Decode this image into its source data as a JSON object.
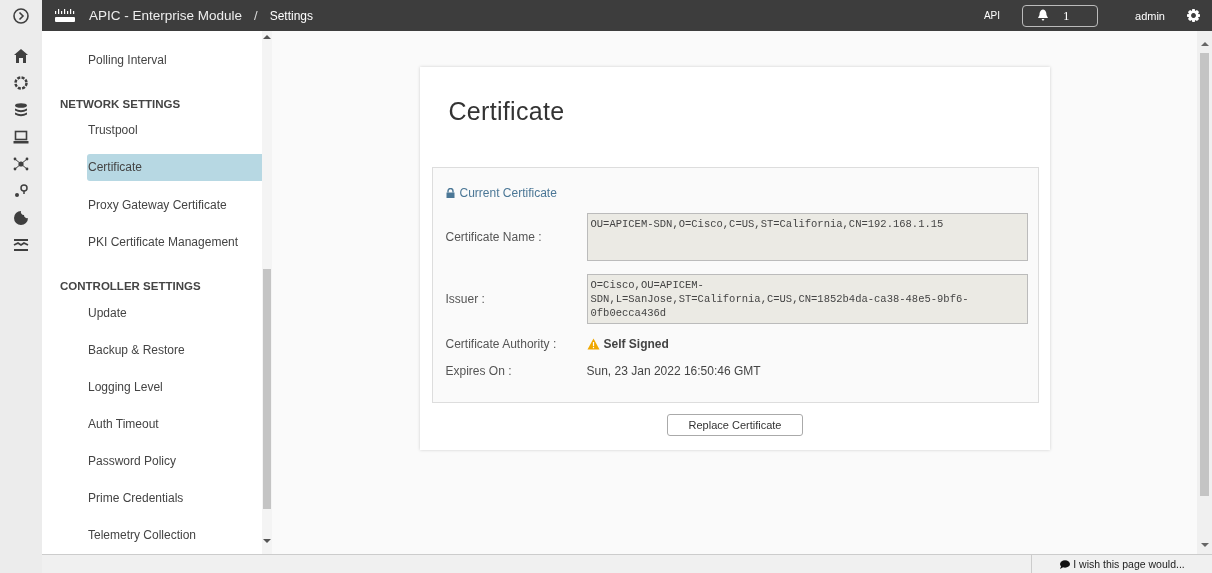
{
  "topbar": {
    "brand": "APIC - Enterprise Module",
    "separator": "/",
    "page": "Settings",
    "api_link": "API",
    "notifications": "1",
    "user": "admin"
  },
  "sidebar": {
    "top_items": [
      {
        "label": "Polling Interval",
        "selected": false
      }
    ],
    "sections": [
      {
        "heading": "NETWORK SETTINGS",
        "items": [
          {
            "label": "Trustpool",
            "selected": false
          },
          {
            "label": "Certificate",
            "selected": true
          },
          {
            "label": "Proxy Gateway Certificate",
            "selected": false
          },
          {
            "label": "PKI Certificate Management",
            "selected": false
          }
        ]
      },
      {
        "heading": "CONTROLLER SETTINGS",
        "items": [
          {
            "label": "Update",
            "selected": false
          },
          {
            "label": "Backup & Restore",
            "selected": false
          },
          {
            "label": "Logging Level",
            "selected": false
          },
          {
            "label": "Auth Timeout",
            "selected": false
          },
          {
            "label": "Password Policy",
            "selected": false
          },
          {
            "label": "Prime Credentials",
            "selected": false
          },
          {
            "label": "Telemetry Collection",
            "selected": false
          }
        ]
      }
    ]
  },
  "certificate": {
    "title": "Certificate",
    "panel_title": "Current Certificate",
    "fields": [
      {
        "kind": "textarea",
        "label": "Certificate Name :",
        "lines": [
          "OU=APICEM-SDN,O=Cisco,C=US,ST=California,CN=192.168.1.15"
        ]
      },
      {
        "kind": "textarea",
        "label": "Issuer :",
        "lines": [
          "O=Cisco,OU=APICEM-",
          "SDN,L=SanJose,ST=California,C=US,CN=1852b4da-ca38-48e5-9bf6-",
          "0fb0ecca436d"
        ]
      },
      {
        "kind": "warning",
        "label": "Certificate Authority :",
        "value": "Self Signed"
      },
      {
        "kind": "text",
        "label": "Expires On :",
        "value": "Sun, 23 Jan 2022 16:50:46 GMT"
      }
    ],
    "button": "Replace Certificate"
  },
  "feedback": "I wish this page would..."
}
